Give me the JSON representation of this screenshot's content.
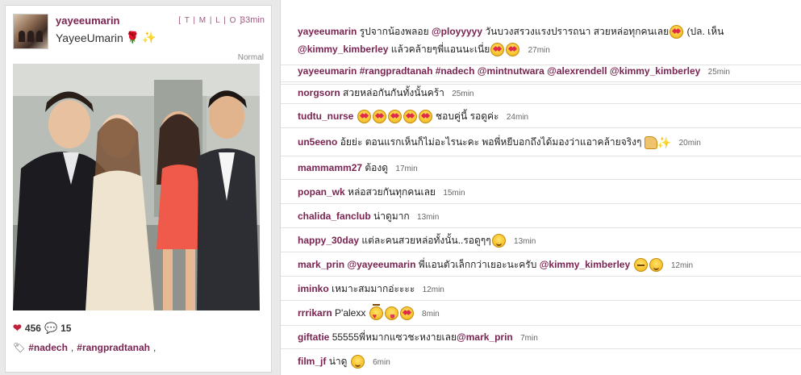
{
  "post": {
    "username": "yayeeumarin",
    "caption": "YayeeUmarin",
    "size_links": [
      "T",
      "M",
      "L",
      "O"
    ],
    "time": "33min",
    "filter": "Normal",
    "likes_count": "456",
    "comments_count": "15",
    "tags": [
      "#nadech",
      "#rangpradtanah"
    ],
    "icons": {
      "caption_emoji": [
        "rose-icon",
        "sparkles-icon"
      ],
      "likes": "heart-icon",
      "comments": "speech-bubble-icon",
      "tags": "tag-icon"
    }
  },
  "comments": [
    {
      "user": "yayeeumarin",
      "line1": "รูปจากน้องพลอย",
      "mention1": "@ployyyyy",
      "line1b": "วันบวงสรวงแรงปรารถนา สวยหล่อทุกคนเลย",
      "line1c": "(ปล. เห็น",
      "mention2": "@kimmy_kimberley",
      "line2": "แล้วคล้ายๆพี่แอนนะเนี่ย",
      "time": "27min"
    },
    {
      "user": "yayeeumarin",
      "tags": "#rangpradtanah #nadech @mintnutwara @alexrendell @kimmy_kimberley",
      "time": "25min"
    },
    {
      "user": "norgsorn",
      "text": "สวยหล่อกันกันทั้งนั้นคร้า",
      "time": "25min"
    },
    {
      "user": "tudtu_nurse",
      "text": "ชอบคู่นี้ รอดูค่ะ",
      "time": "24min"
    },
    {
      "user": "un5eeno",
      "text": "อ้ยย่ะ ตอนแรกเห็นก็ไม่อะไรนะคะ พอพี่หยีบอกถึงได้มองว่าแอาคล้ายจริงๆ",
      "time": "20min"
    },
    {
      "user": "mammamm27",
      "text": "ต้องดู",
      "time": "17min"
    },
    {
      "user": "popan_wk",
      "text": "หล่อสวยกันทุกคนเลย",
      "time": "15min"
    },
    {
      "user": "chalida_fanclub",
      "text": "น่าดูมาก",
      "time": "13min"
    },
    {
      "user": "happy_30day",
      "text": "แต่ละคนสวยหล่อทั้งนั้น..รอดูๆๆ",
      "time": "13min"
    },
    {
      "user": "mark_prin",
      "mention1": "@yayeeumarin",
      "text": "พี่แอนตัวเล็กกว่าเยอะนะครับ",
      "mention2": "@kimmy_kimberley",
      "time": "12min"
    },
    {
      "user": "iminko",
      "text": "เหมาะสมมากอ่ะะะะ",
      "time": "12min"
    },
    {
      "user": "rrrikarn",
      "text": "P'alexx",
      "time": "8min"
    },
    {
      "user": "giftatie",
      "text": "55555พี่หมากแซวชะหงายเลย",
      "mention1": "@mark_prin",
      "time": "7min"
    },
    {
      "user": "film_jf",
      "text": "น่าดู",
      "time": "6min"
    }
  ]
}
